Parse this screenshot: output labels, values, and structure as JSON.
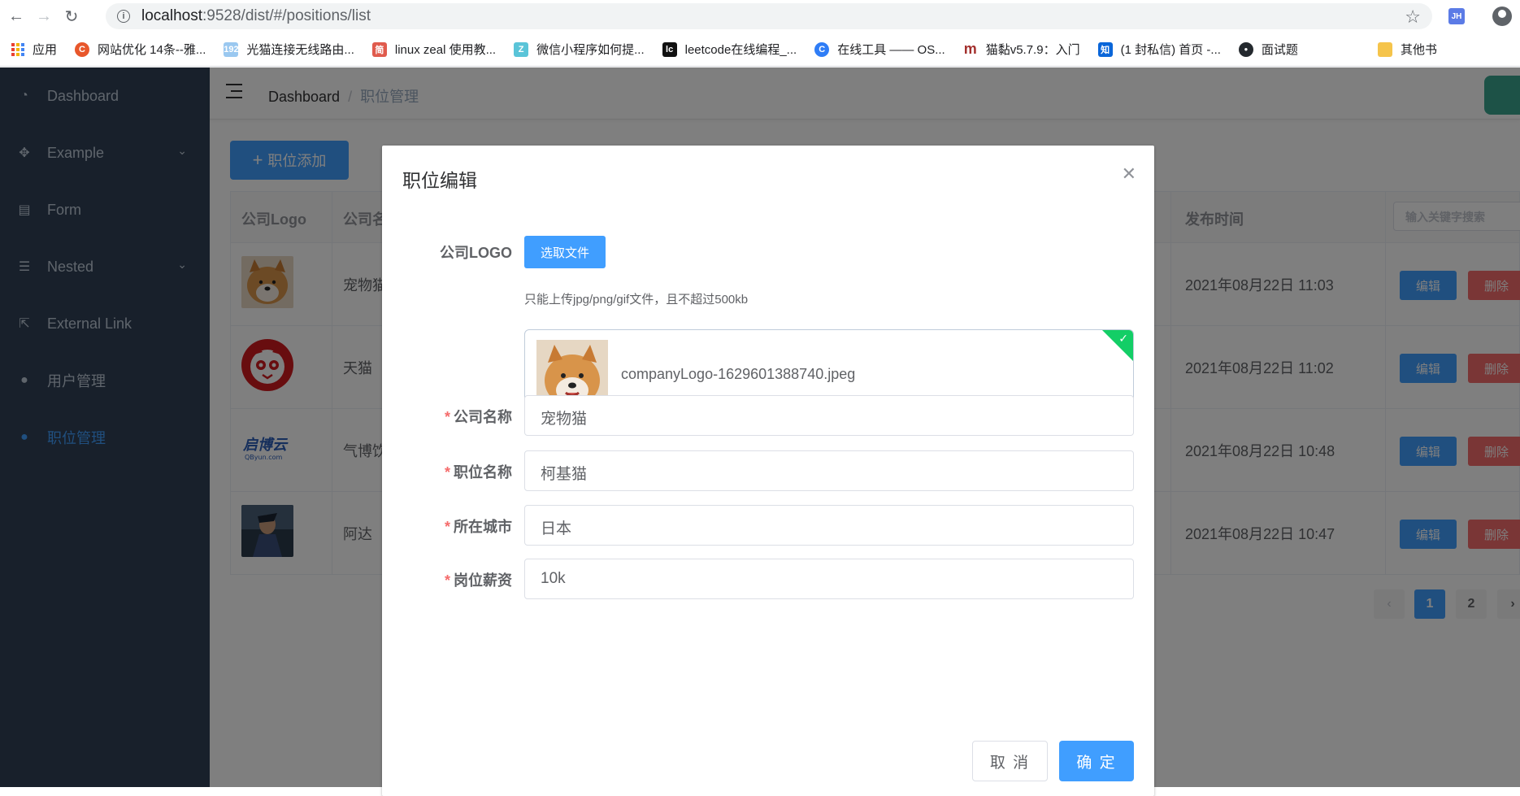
{
  "browser": {
    "url_host": "localhost",
    "url_path": ":9528/dist/#/positions/list",
    "ext_label": "JH",
    "bookmarks": [
      {
        "label": "应用",
        "icon": "apps-icon"
      },
      {
        "label": "网站优化 14条--雅...",
        "icon": "c-icon",
        "color": "#e8572b",
        "glyph": "C"
      },
      {
        "label": "光猫连接无线路由...",
        "icon": "192-icon",
        "color": "#9ac8f0",
        "glyph": "192"
      },
      {
        "label": "linux zeal 使用教...",
        "icon": "jian-icon",
        "color": "#e05b4d",
        "glyph": "简"
      },
      {
        "label": "微信小程序如何提...",
        "icon": "z-icon",
        "color": "#5ac4d8",
        "glyph": "Z"
      },
      {
        "label": "leetcode在线编程_...",
        "icon": "lc-icon",
        "color": "#111111",
        "glyph": "lc"
      },
      {
        "label": "在线工具 —— OS...",
        "icon": "c-blue-icon",
        "color": "#2f7df6",
        "glyph": "C"
      },
      {
        "label": "猫黏v5.7.9：入门",
        "icon": "m-icon",
        "color": "#ffffff",
        "glyph": "m"
      },
      {
        "label": "(1 封私信) 首页 -...",
        "icon": "zhihu-icon",
        "color": "#0a66d9",
        "glyph": "知"
      },
      {
        "label": "面试题",
        "icon": "github-icon",
        "color": "#24292e",
        "glyph": "●"
      },
      {
        "label": "其他书",
        "icon": "folder-icon",
        "color": "#f5c44b",
        "glyph": ""
      }
    ]
  },
  "sidebar": {
    "items": [
      {
        "label": "Dashboard",
        "icon": "dashboard-icon",
        "glyph": "◔",
        "active": false,
        "sub": false
      },
      {
        "label": "Example",
        "icon": "example-icon",
        "glyph": "✥",
        "active": false,
        "sub": true
      },
      {
        "label": "Form",
        "icon": "form-icon",
        "glyph": "▤",
        "active": false,
        "sub": false
      },
      {
        "label": "Nested",
        "icon": "nested-icon",
        "glyph": "☰",
        "active": false,
        "sub": true
      },
      {
        "label": "External Link",
        "icon": "external-link-icon",
        "glyph": "⇱",
        "active": false,
        "sub": false
      },
      {
        "label": "用户管理",
        "icon": "user-icon",
        "glyph": "●",
        "active": false,
        "sub": false
      },
      {
        "label": "职位管理",
        "icon": "position-icon",
        "glyph": "●",
        "active": true,
        "sub": false
      }
    ]
  },
  "navbar": {
    "breadcrumb_home": "Dashboard",
    "breadcrumb_sep": "/",
    "breadcrumb_current": "职位管理"
  },
  "toolbar": {
    "add_label": "职位添加"
  },
  "table": {
    "headers": {
      "logo": "公司Logo",
      "name": "公司名称",
      "time": "发布时间"
    },
    "search_placeholder": "输入关键字搜索",
    "rows": [
      {
        "company": "宠物猫",
        "time": "2021年08月22日 11:03",
        "logo": "shiba-logo"
      },
      {
        "company": "天猫",
        "time": "2021年08月22日 11:02",
        "logo": "tmall-logo"
      },
      {
        "company": "气博饮",
        "time": "2021年08月22日 10:48",
        "logo": "qbyun-logo"
      },
      {
        "company": "阿达",
        "time": "2021年08月22日 10:47",
        "logo": "ada-logo"
      }
    ],
    "edit_label": "编辑",
    "delete_label": "删除",
    "qbyun_text": "启博云",
    "qbyun_sub": "QByun.com"
  },
  "pagination": {
    "prev": "‹",
    "next": "›",
    "pages": [
      "1",
      "2"
    ],
    "current": "1"
  },
  "dialog": {
    "title": "职位编辑",
    "logo_label": "公司LOGO",
    "upload_button": "选取文件",
    "upload_tip": "只能上传jpg/png/gif文件，且不超过500kb",
    "file_name": "companyLogo-1629601388740.jpeg",
    "fields": [
      {
        "label": "公司名称",
        "value": "宠物猫"
      },
      {
        "label": "职位名称",
        "value": "柯基猫"
      },
      {
        "label": "所在城市",
        "value": "日本"
      },
      {
        "label": "岗位薪资",
        "value": "10k"
      }
    ],
    "required_mark": "*",
    "cancel": "取 消",
    "confirm": "确 定"
  }
}
